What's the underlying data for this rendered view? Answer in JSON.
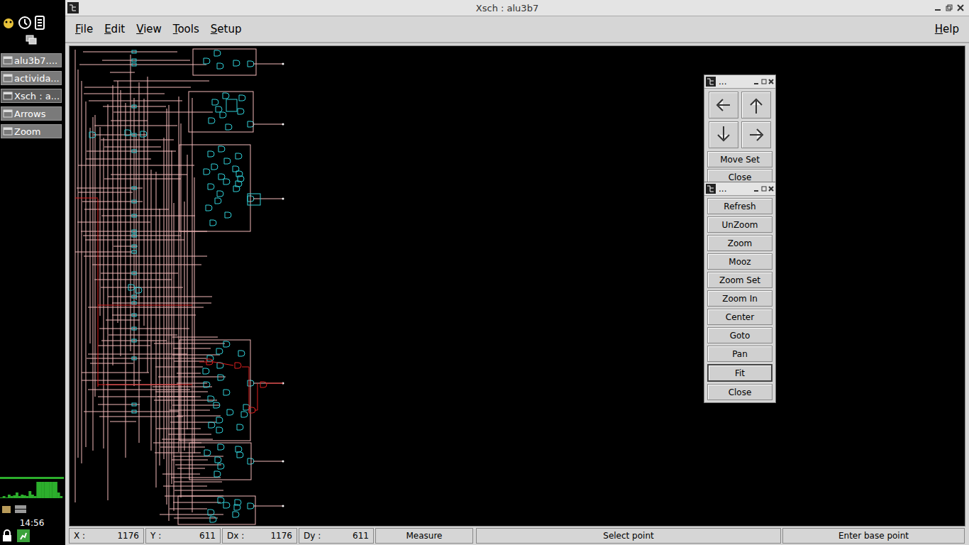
{
  "window": {
    "title": "Xsch : alu3b7"
  },
  "menu": [
    {
      "label": "File"
    },
    {
      "label": "Edit"
    },
    {
      "label": "View"
    },
    {
      "label": "Tools"
    },
    {
      "label": "Setup"
    }
  ],
  "help_menu": "Help",
  "taskbar": {
    "items": [
      {
        "label": "alu3b7....",
        "selected": false
      },
      {
        "label": "activida...",
        "selected": false
      },
      {
        "label": "Xsch : a...",
        "selected": true
      },
      {
        "label": "Arrows",
        "selected": false
      },
      {
        "label": "Zoom",
        "selected": false
      }
    ],
    "clock": "14:56",
    "cpu_history": [
      0.05,
      0.1,
      0.05,
      0.2,
      0.1,
      0.15,
      0.3,
      0.1,
      0.2,
      0.15,
      0.1,
      0.4,
      0.2,
      0.1,
      0.9,
      0.9,
      0.9,
      0.9,
      0.9,
      0.9,
      0.9,
      0.9,
      0.3,
      0.1
    ]
  },
  "status_bar": {
    "fields": [
      {
        "label": "X :",
        "value": "1176"
      },
      {
        "label": "Y :",
        "value": "611"
      },
      {
        "label": "Dx :",
        "value": "1176"
      },
      {
        "label": "Dy :",
        "value": "611"
      }
    ],
    "messages": [
      "Measure",
      "Select point",
      "Enter base point"
    ]
  },
  "arrows_panel": {
    "title": "...",
    "buttons": [
      "Move Set",
      "Close"
    ]
  },
  "zoom_panel": {
    "title": "...",
    "buttons": [
      {
        "label": "Refresh",
        "focused": false
      },
      {
        "label": "UnZoom",
        "focused": false
      },
      {
        "label": "Zoom",
        "focused": false
      },
      {
        "label": "Mooz",
        "focused": false
      },
      {
        "label": "Zoom Set",
        "focused": false
      },
      {
        "label": "Zoom In",
        "focused": false
      },
      {
        "label": "Center",
        "focused": false
      },
      {
        "label": "Goto",
        "focused": false
      },
      {
        "label": "Pan",
        "focused": false
      },
      {
        "label": "Fit",
        "focused": true
      },
      {
        "label": "Close",
        "focused": false
      }
    ]
  }
}
